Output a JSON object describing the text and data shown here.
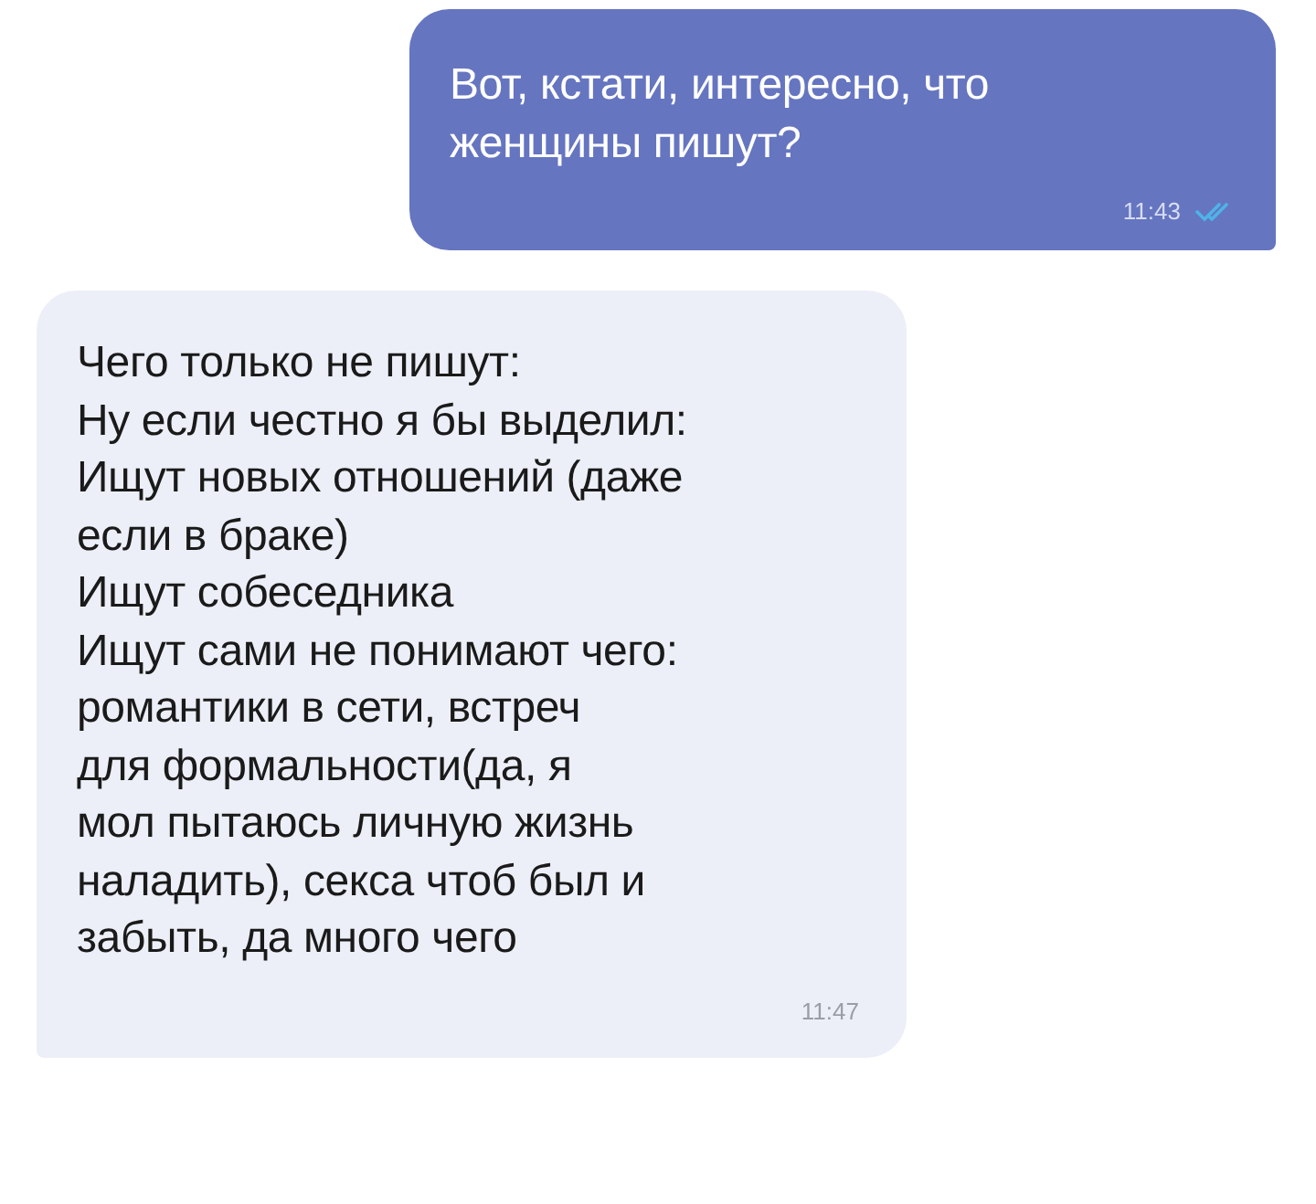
{
  "messages": [
    {
      "kind": "outgoing",
      "text": "Вот, кстати, интересно, что\nженщины пишут?",
      "time": "11:43",
      "read": true
    },
    {
      "kind": "incoming",
      "text": "Чего только не пишут:\nНу если честно я бы выделил:\nИщут новых отношений (даже\nесли в браке)\nИщут собеседника\nИщут сами не понимают чего:\nромантики в сети, встреч\nдля формальности(да, я\nмол пытаюсь личную жизнь\nналадить), секса чтоб был и\nзабыть, да много чего",
      "time": "11:47"
    }
  ]
}
